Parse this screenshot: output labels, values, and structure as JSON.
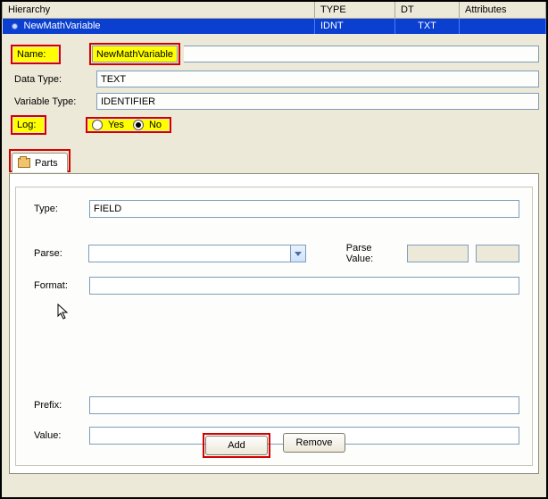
{
  "table": {
    "headers": {
      "hierarchy": "Hierarchy",
      "type": "TYPE",
      "dt": "DT",
      "attributes": "Attributes"
    },
    "row": {
      "name": "NewMathVariable",
      "type": "IDNT",
      "dt": "TXT",
      "attributes": ""
    }
  },
  "form": {
    "name_label": "Name:",
    "name_value": "NewMathVariable",
    "datatype_label": "Data Type:",
    "datatype_value": "TEXT",
    "vartype_label": "Variable Type:",
    "vartype_value": "IDENTIFIER",
    "log_label": "Log:",
    "log_yes": "Yes",
    "log_no": "No"
  },
  "tab": {
    "label": "Parts"
  },
  "parts": {
    "type_label": "Type:",
    "type_value": "FIELD",
    "parse_label": "Parse:",
    "parse_value_label": "Parse Value:",
    "format_label": "Format:",
    "prefix_label": "Prefix:",
    "value_label": "Value:",
    "add": "Add",
    "remove": "Remove"
  }
}
